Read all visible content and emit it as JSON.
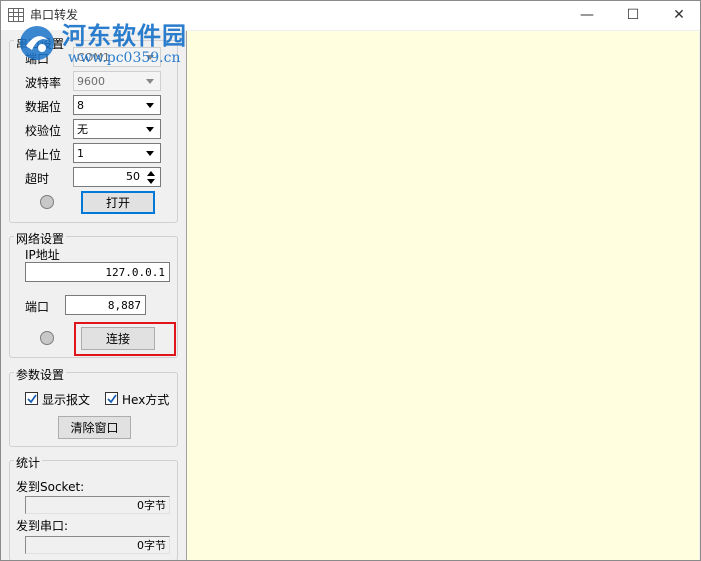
{
  "window": {
    "title": "串口转发",
    "min_glyph": "—",
    "max_glyph": "☐",
    "close_glyph": "✕"
  },
  "watermark": {
    "site_name": "河东软件园",
    "url": "www.pc0359.cn"
  },
  "serial": {
    "group_title": "串口设置",
    "port_label": "端口",
    "port_value": "COM1",
    "baud_label": "波特率",
    "baud_value": "9600",
    "databits_label": "数据位",
    "databits_value": "8",
    "parity_label": "校验位",
    "parity_value": "无",
    "stopbits_label": "停止位",
    "stopbits_value": "1",
    "timeout_label": "超时",
    "timeout_value": "50",
    "open_button": "打开"
  },
  "network": {
    "group_title": "网络设置",
    "ip_label": "IP地址",
    "ip_value": "127.0.0.1",
    "port_label": "端口",
    "port_value": "8,887",
    "connect_button": "连接"
  },
  "params": {
    "group_title": "参数设置",
    "show_msg_label": "显示报文",
    "show_msg_checked": true,
    "hex_label": "Hex方式",
    "hex_checked": true,
    "clear_button": "清除窗口"
  },
  "stats": {
    "group_title": "统计",
    "to_socket_label": "发到Socket:",
    "to_socket_value": "0字节",
    "to_serial_label": "发到串口:",
    "to_serial_value": "0字节"
  },
  "colors": {
    "output_bg": "#ffffe0",
    "highlight": "#e0141b",
    "watermark": "#1a73c9"
  }
}
